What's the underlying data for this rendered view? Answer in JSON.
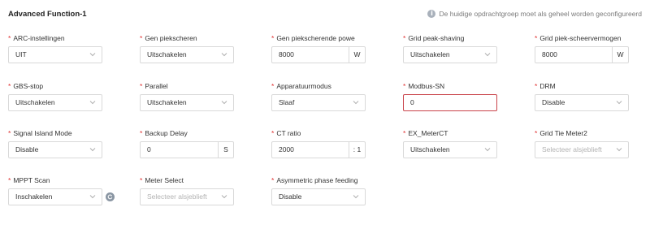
{
  "header": {
    "title": "Advanced Function-1",
    "notice": "De huidige opdrachtgroep moet als geheel worden geconfigureerd"
  },
  "fields": {
    "arc": {
      "label": "ARC-instellingen",
      "value": "UIT"
    },
    "gen_peak": {
      "label": "Gen piekscheren",
      "value": "Uitschakelen"
    },
    "gen_peak_power": {
      "label": "Gen piekscherende powe",
      "value": "8000",
      "unit": "W"
    },
    "grid_peak": {
      "label": "Grid peak-shaving",
      "value": "Uitschakelen"
    },
    "grid_peak_power": {
      "label": "Grid piek-scheervermogen",
      "value": "8000",
      "unit": "W"
    },
    "gbs_stop": {
      "label": "GBS-stop",
      "value": "Uitschakelen"
    },
    "parallel": {
      "label": "Parallel",
      "value": "Uitschakelen"
    },
    "device_mode": {
      "label": "Apparatuurmodus",
      "value": "Slaaf"
    },
    "modbus_sn": {
      "label": "Modbus-SN",
      "value": "0"
    },
    "drm": {
      "label": "DRM",
      "value": "Disable"
    },
    "signal_island": {
      "label": "Signal Island Mode",
      "value": "Disable"
    },
    "backup_delay": {
      "label": "Backup Delay",
      "value": "0",
      "unit": "S"
    },
    "ct_ratio": {
      "label": "CT ratio",
      "value": "2000",
      "unit": ": 1"
    },
    "ex_meter_ct": {
      "label": "EX_MeterCT",
      "value": "Uitschakelen"
    },
    "grid_tie_meter2": {
      "label": "Grid Tie Meter2",
      "placeholder": "Selecteer alsjeblieft"
    },
    "mppt_scan": {
      "label": "MPPT Scan",
      "value": "Inschakelen"
    },
    "meter_select": {
      "label": "Meter Select",
      "placeholder": "Selecteer alsjeblieft"
    },
    "asym_phase": {
      "label": "Asymmetric phase feeding",
      "value": "Disable"
    }
  },
  "colors": {
    "required": "#e03131",
    "error_border": "#c9434a",
    "border": "#d9d9d9"
  }
}
